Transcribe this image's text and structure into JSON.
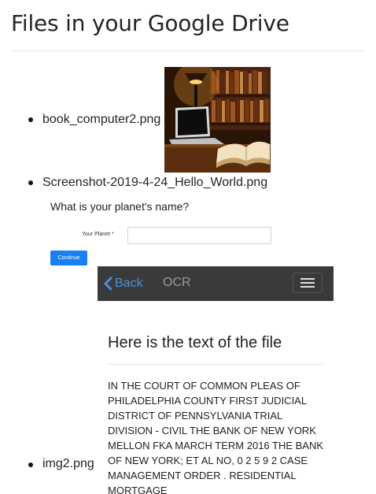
{
  "page": {
    "title": "Files in your Google Drive"
  },
  "files": [
    {
      "name": "book_computer2.png"
    },
    {
      "name": "Screenshot-2019-4-24_Hello_World.png"
    },
    {
      "name": "img2.png"
    }
  ],
  "hello_world": {
    "question": "What is your planet's name?",
    "field_label": "Your Planet",
    "required_mark": "*",
    "field_value": "",
    "button_label": "Continue",
    "button_color": "#1a7ff5"
  },
  "ocr_app": {
    "back_label": "Back",
    "brand": "OCR",
    "heading": "Here is the text of the file",
    "body_text": "IN THE COURT OF COMMON PLEAS OF PHILADELPHIA COUNTY FIRST JUDICIAL DISTRICT OF PENNSYLVANIA TRIAL DIVISION - CIVIL THE BANK OF NEW YORK MELLON FKA MARCH TERM 2016 THE BANK OF NEW YORK; ET AL No, 0 2 5 9 2 CASE MANAGEMENT ORDER . RESIDENTIAL MORTGAGE",
    "navbar_color": "#3a3a3a",
    "back_color": "#4a90d9"
  },
  "icons": {
    "back": "chevron-left-icon",
    "menu": "hamburger-menu-icon"
  }
}
